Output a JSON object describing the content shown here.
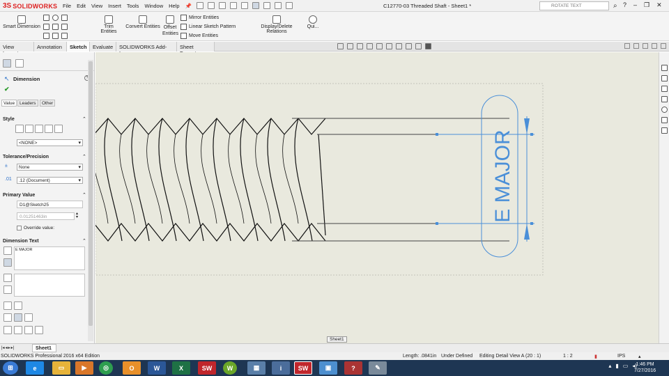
{
  "app": {
    "logo_ds": "3S",
    "logo_name": "SOLIDWORKS",
    "document_title": "C12770-03 Threaded Shaft - Sheet1 *",
    "search_placeholder": "ROTATE TEXT"
  },
  "menu": [
    "File",
    "Edit",
    "View",
    "Insert",
    "Tools",
    "Window",
    "Help"
  ],
  "ribbon": {
    "smart_dimension": "Smart Dimension",
    "trim_entities": "Trim Entities",
    "convert_entities": "Convert Entities",
    "offset_entities_1": "Offset",
    "offset_entities_2": "Entities",
    "mirror_entities": "Mirror Entities",
    "linear_sketch_pattern": "Linear Sketch Pattern",
    "move_entities": "Move Entities",
    "display_delete_relations": "Display/Delete Relations",
    "quick_snaps": "Qui..."
  },
  "tabs": [
    "View Layout",
    "Annotation",
    "Sketch",
    "Evaluate",
    "SOLIDWORKS Add-Ins",
    "Sheet Format"
  ],
  "active_tab": "Sketch",
  "property_manager": {
    "title": "Dimension",
    "subtabs": [
      "Value",
      "Leaders",
      "Other"
    ],
    "style_label": "Style",
    "style_value": "<NONE>",
    "tolerance_label": "Tolerance/Precision",
    "tolerance_value": "None",
    "precision_value": ".12 (Document)",
    "primary_value_label": "Primary Value",
    "primary_name": "D1@Sketch25",
    "primary_number": "0.01251463in",
    "override_label": "Override value:",
    "dimension_text_label": "Dimension Text",
    "dimension_text_value": "E MAJOR"
  },
  "drawing": {
    "dimension_text": "E MAJOR",
    "sheet_hint": "Sheet1",
    "accent_color": "#4a8fd8"
  },
  "sheet_tab": "Sheet1",
  "status": {
    "edition": "SOLIDWORKS Professional 2016 x64 Edition",
    "length": "Length: .0841in",
    "definition": "Under Defined",
    "editing": "Editing Detail View A (20 : 1)",
    "scale": "1 : 2",
    "units": "IPS"
  },
  "clock": {
    "time": "1:46 PM",
    "date": "7/27/2016"
  }
}
